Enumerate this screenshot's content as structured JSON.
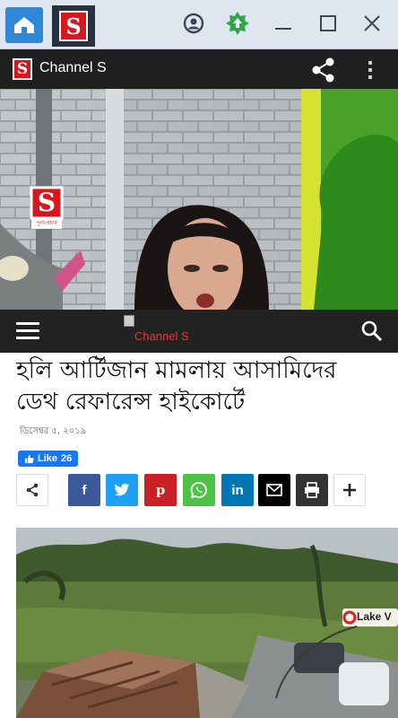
{
  "window": {
    "tab_logo_letter": "S",
    "icons": [
      "home-icon",
      "account-icon",
      "update-icon",
      "minimize-icon",
      "maximize-icon",
      "close-icon"
    ]
  },
  "appbar": {
    "logo_letter": "S",
    "title": "Channel S",
    "icons": [
      "share-icon",
      "more-vert-icon"
    ]
  },
  "video": {
    "logo_letter": "S",
    "logo_caption": "পূনঃপ্রচার"
  },
  "site_nav": {
    "logo_alt": "Channel S",
    "icons": [
      "menu-icon",
      "search-icon"
    ]
  },
  "article": {
    "headline_line1": "হলি আর্টিজান মামলায় আসামিদের",
    "headline_line2": "ডেথ রেফারেন্স হাইকোর্টে",
    "date": "ডিসেম্বর ৫, ২০১৯",
    "like_label": "Like",
    "like_count": "26"
  },
  "share_buttons": [
    {
      "name": "share",
      "label": "<",
      "color": "#ffffff"
    },
    {
      "name": "facebook",
      "label": "f",
      "color": "#3b5998"
    },
    {
      "name": "twitter",
      "label": "t",
      "color": "#1da1f2"
    },
    {
      "name": "pinterest",
      "label": "p",
      "color": "#ca2127"
    },
    {
      "name": "whatsapp",
      "label": "w",
      "color": "#4dc247"
    },
    {
      "name": "linkedin",
      "label": "in",
      "color": "#0077b5"
    },
    {
      "name": "email",
      "label": "✉",
      "color": "#000000"
    },
    {
      "name": "print",
      "label": "⎙",
      "color": "#333333"
    },
    {
      "name": "more",
      "label": "+",
      "color": "#ffffff"
    }
  ],
  "photo": {
    "sign_text": "Lake V"
  },
  "colors": {
    "brand_red": "#d7171f",
    "appbar_bg": "#1f1f1f",
    "nav_bg": "#222222",
    "chrome_bg": "#dfe6f0"
  }
}
